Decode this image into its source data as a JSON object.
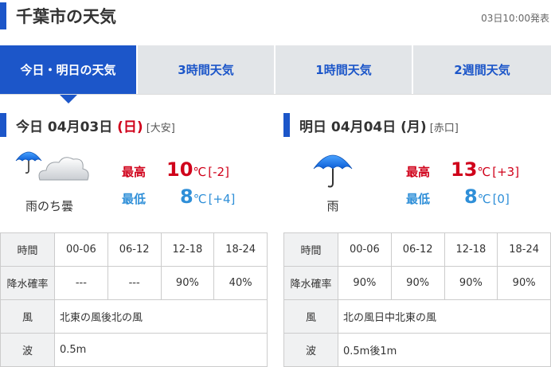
{
  "header": {
    "title": "千葉市の天気",
    "published": "03日10:00発表"
  },
  "tabs": [
    {
      "label": "今日・明日の天気",
      "active": true
    },
    {
      "label": "3時間天気",
      "active": false
    },
    {
      "label": "1時間天気",
      "active": false
    },
    {
      "label": "2週間天気",
      "active": false
    }
  ],
  "colors": {
    "accent": "#1c56c9",
    "tab_inactive_bg": "#e2e5e8",
    "high_temp": "#d0021b",
    "low_temp": "#2f8fd8"
  },
  "today": {
    "label_prefix": "今日 04月03日 ",
    "dow": "(日)",
    "rokuyo": "[大安]",
    "icon": "umbrella-cloud-icon",
    "weather": "雨のち曇",
    "high_label": "最高",
    "high_value": "10",
    "high_unit": "℃",
    "high_diff": "[-2]",
    "low_label": "最低",
    "low_value": "8",
    "low_unit": "℃",
    "low_diff": "[+4]",
    "table": {
      "time_header": "時間",
      "times": [
        "00-06",
        "06-12",
        "12-18",
        "18-24"
      ],
      "rain_header": "降水確率",
      "rain": [
        "---",
        "---",
        "90%",
        "40%"
      ],
      "wind_header": "風",
      "wind": "北東の風後北の風",
      "wave_header": "波",
      "wave": "0.5m"
    }
  },
  "tomorrow": {
    "label_prefix": "明日 04月04日 ",
    "dow": "(月)",
    "rokuyo": "[赤口]",
    "icon": "umbrella-icon",
    "weather": "雨",
    "high_label": "最高",
    "high_value": "13",
    "high_unit": "℃",
    "high_diff": "[+3]",
    "low_label": "最低",
    "low_value": "8",
    "low_unit": "℃",
    "low_diff": "[0]",
    "table": {
      "time_header": "時間",
      "times": [
        "00-06",
        "06-12",
        "12-18",
        "18-24"
      ],
      "rain_header": "降水確率",
      "rain": [
        "90%",
        "90%",
        "90%",
        "90%"
      ],
      "wind_header": "風",
      "wind": "北の風日中北東の風",
      "wave_header": "波",
      "wave": "0.5m後1m"
    }
  }
}
